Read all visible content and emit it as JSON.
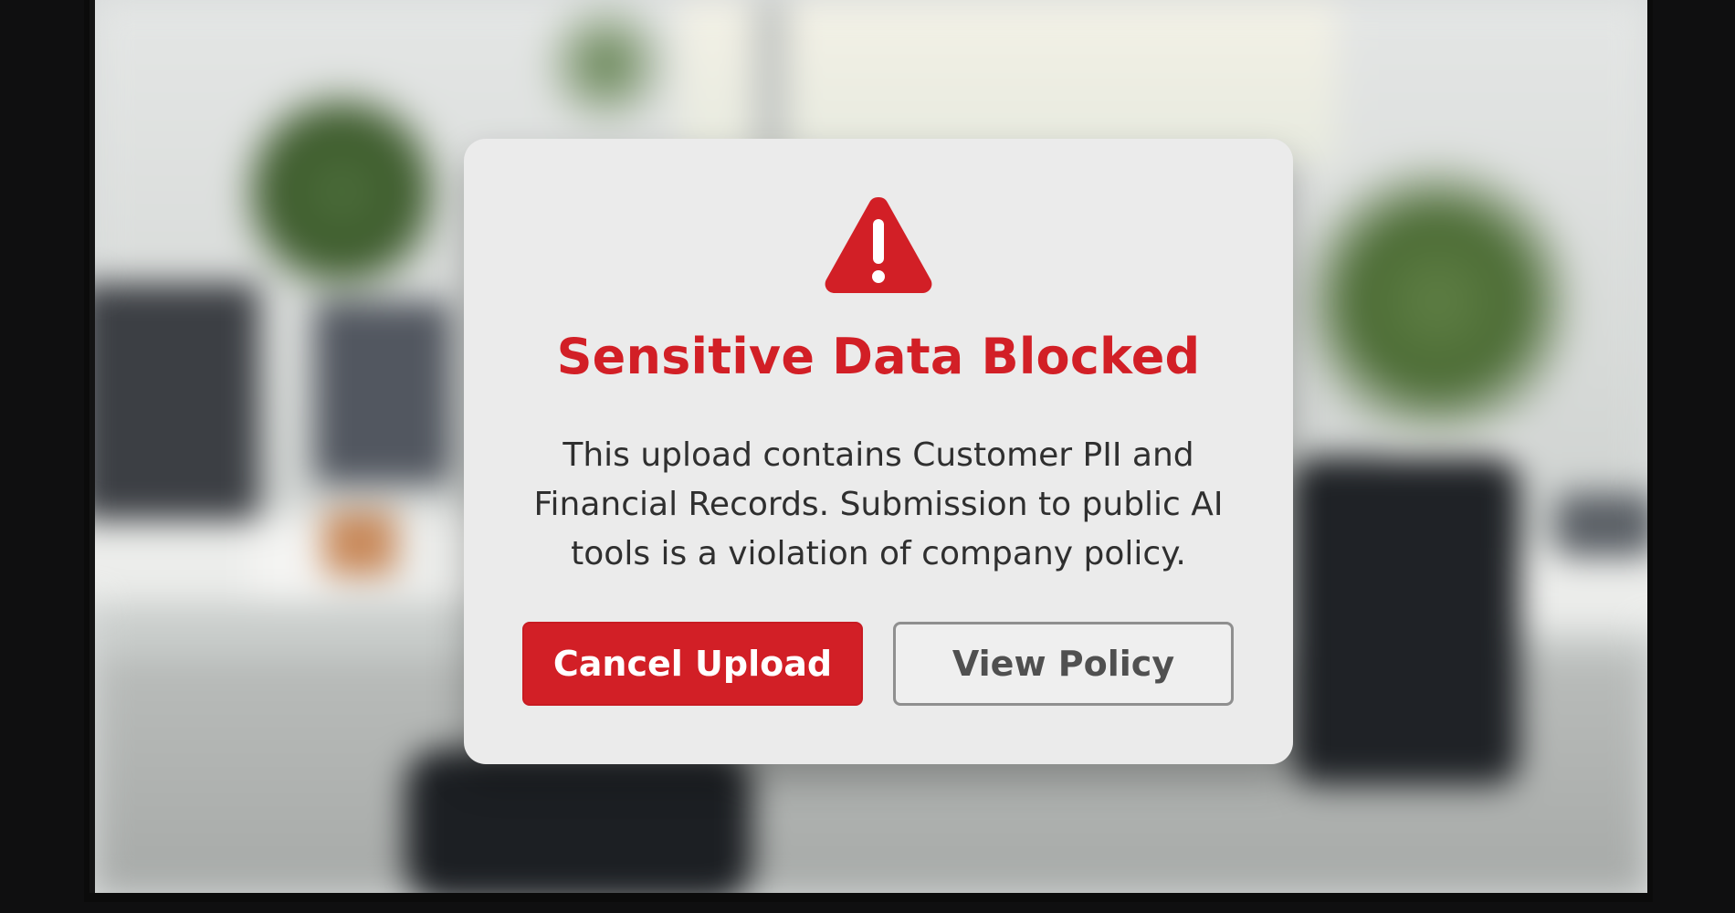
{
  "dialog": {
    "title": "Sensitive Data Blocked",
    "message": "This upload contains Customer PII and Financial Records. Submission to public AI tools is a violation of company policy.",
    "icon": "warning-triangle-icon",
    "actions": {
      "primary_label": "Cancel Upload",
      "secondary_label": "View Policy"
    }
  },
  "colors": {
    "accent_red": "#d21f26",
    "dialog_bg": "#ebebeb",
    "text_dark": "#2f2f2f",
    "secondary_text": "#505050",
    "secondary_border": "#8f8f8f"
  }
}
